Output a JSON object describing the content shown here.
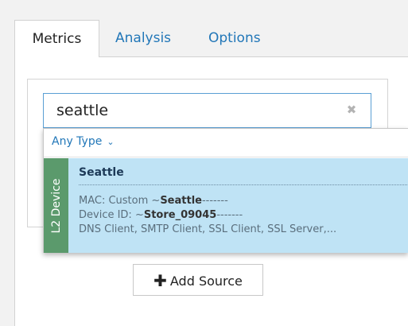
{
  "tabs": [
    {
      "label": "Metrics",
      "active": true
    },
    {
      "label": "Analysis",
      "active": false
    },
    {
      "label": "Options",
      "active": false
    }
  ],
  "search": {
    "value": "seattle",
    "clear_icon": "close-icon"
  },
  "dropdown": {
    "filter_label": "Any Type",
    "filter_chevron": "⌄",
    "results": [
      {
        "type_label": "L2 Device",
        "type_color": "#5b9a6c",
        "title": "Seattle",
        "mac_prefix": "MAC: Custom ~",
        "mac_match": "Seattle",
        "mac_suffix": "-------",
        "device_prefix": "Device ID: ~",
        "device_match": "Store_09045",
        "device_suffix": "-------",
        "services": "DNS Client, SMTP Client, SSL Client, SSL Server,..."
      }
    ]
  },
  "actions": {
    "add_source_icon": "plus-icon",
    "add_source_label": "Add Source"
  },
  "colors": {
    "link": "#2277b8",
    "highlight": "#bfe3f5",
    "search_border": "#5a9fd4"
  }
}
